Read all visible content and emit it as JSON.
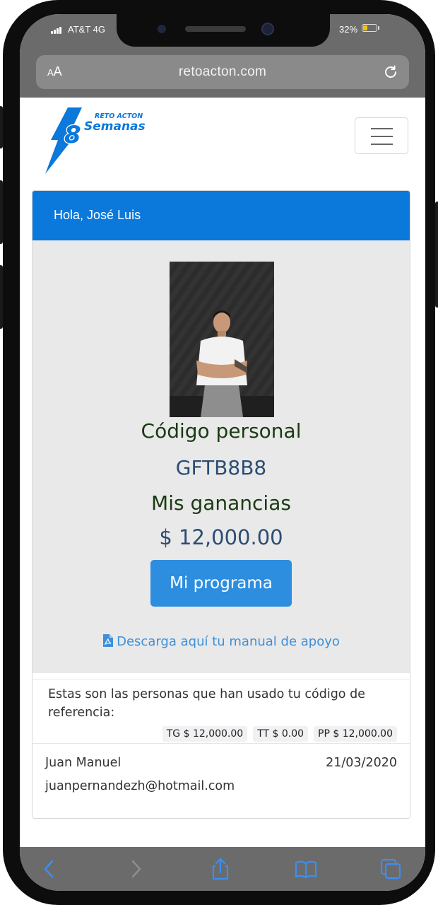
{
  "status_bar": {
    "carrier": "AT&T 4G",
    "battery_percent": "32%",
    "battery_level": 0.32,
    "battery_color": "#f7c600"
  },
  "browser": {
    "text_size_label_small": "A",
    "text_size_label_big": "A",
    "url": "retoacton.com",
    "reload_icon": "reload-icon"
  },
  "site": {
    "logo_top_text": "RETO ACTON",
    "logo_number": "8",
    "logo_word": "Semanas",
    "brand_color": "#0b78db"
  },
  "card": {
    "greeting": "Hola, José Luis",
    "code_label": "Código personal",
    "code_value": "GFTB8B8",
    "earnings_label": "Mis ganancias",
    "earnings_value": "$ 12,000.00",
    "program_button": "Mi programa",
    "download_link": "Descarga aquí tu manual de apoyo"
  },
  "referrals": {
    "intro": "Estas son las personas que han usado tu código de referencia:",
    "totals": [
      {
        "label": "TG $ 12,000.00"
      },
      {
        "label": "TT $ 0.00"
      },
      {
        "label": "PP $ 12,000.00"
      }
    ],
    "rows": [
      {
        "name": "Juan Manuel",
        "date": "21/03/2020",
        "email": "juanpernandezh@hotmail.com"
      }
    ]
  },
  "toolbar": {
    "icons": [
      "back-icon",
      "forward-icon",
      "share-icon",
      "bookmarks-icon",
      "tabs-icon"
    ]
  }
}
